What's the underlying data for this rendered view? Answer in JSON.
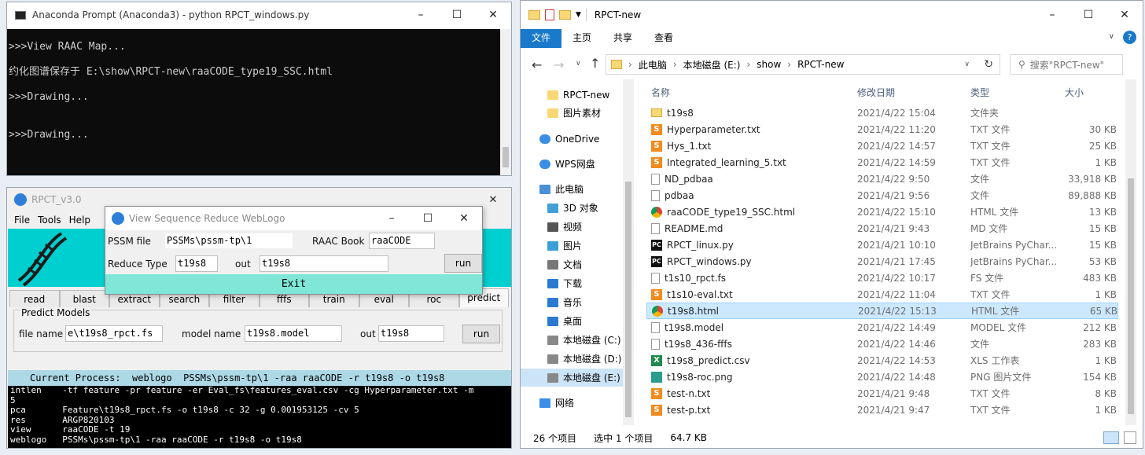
{
  "cmd": {
    "title": "Anaconda Prompt (Anaconda3) - python  RPCT_windows.py",
    "lines": [
      ">>>View RAAC Map...",
      "约化图谱保存于 E:\\show\\RPCT-new\\raaCODE_type19_SSC.html",
      ">>>Drawing...",
      "",
      ">>>Drawing...",
      "",
      "_"
    ]
  },
  "rpct": {
    "title": "RPCT_v3.0",
    "menu": [
      "File",
      "Tools",
      "Help"
    ],
    "tabs": [
      "read",
      "blast",
      "extract",
      "search",
      "filter",
      "fffs",
      "train",
      "eval",
      "roc",
      "predict"
    ],
    "group_title": "Predict Models",
    "file_name_label": "file name",
    "file_name_value": "e\\t19s8_rpct.fs",
    "model_name_label": "model name",
    "model_name_value": "t19s8.model",
    "out_label": "out",
    "out_value": "t19s8",
    "run": "run",
    "status": "Current Process:  weblogo  PSSMs\\pssm-tp\\1 -raa raaCODE -r t19s8 -o t19s8",
    "log": [
      "intlen    -tf feature -pr feature -er Eval_fs\\features_eval.csv -cg Hyperparameter.txt -m",
      "5",
      "pca       Feature\\t19s8_rpct.fs -o t19s8 -c 32 -g 0.001953125 -cv 5",
      "res       ARGP820103",
      "view      raaCODE -t 19",
      "weblogo   PSSMs\\pssm-tp\\1 -raa raaCODE -r t19s8 -o t19s8"
    ]
  },
  "popup": {
    "title": "View Sequence Reduce WebLogo",
    "pssm_label": "PSSM file",
    "pssm_value": "PSSMs\\pssm-tp\\1",
    "raac_label": "RAAC Book",
    "raac_value": "raaCODE",
    "reduce_label": "Reduce Type",
    "reduce_value": "t19s8",
    "out_label": "out",
    "out_value": "t19s8",
    "run": "run",
    "exit": "Exit"
  },
  "explorer": {
    "title": "RPCT-new",
    "ribbon": [
      "文件",
      "主页",
      "共享",
      "查看"
    ],
    "breadcrumb": [
      "此电脑",
      "本地磁盘 (E:)",
      "show",
      "RPCT-new"
    ],
    "search_placeholder": "搜索\"RPCT-new\"",
    "nav": [
      {
        "label": "RPCT-new",
        "icon": "folder-icon"
      },
      {
        "label": "图片素材",
        "icon": "folder-icon"
      },
      {
        "label": "OneDrive",
        "icon": "cloud-icon"
      },
      {
        "label": "WPS网盘",
        "icon": "cloud-icon"
      },
      {
        "label": "此电脑",
        "icon": "computer-icon"
      },
      {
        "label": "3D 对象",
        "icon": "cube-icon"
      },
      {
        "label": "视频",
        "icon": "video-icon"
      },
      {
        "label": "图片",
        "icon": "image-icon"
      },
      {
        "label": "文档",
        "icon": "document-icon"
      },
      {
        "label": "下载",
        "icon": "download-icon"
      },
      {
        "label": "音乐",
        "icon": "music-icon"
      },
      {
        "label": "桌面",
        "icon": "desktop-icon"
      },
      {
        "label": "本地磁盘 (C:)",
        "icon": "drive-icon"
      },
      {
        "label": "本地磁盘 (D:)",
        "icon": "drive-icon"
      },
      {
        "label": "本地磁盘 (E:)",
        "icon": "drive-icon"
      },
      {
        "label": "网络",
        "icon": "network-icon"
      }
    ],
    "columns": [
      "名称",
      "修改日期",
      "类型",
      "大小"
    ],
    "files": [
      {
        "name": "t19s8",
        "date": "2021/4/22 15:04",
        "type": "文件夹",
        "size": "",
        "icon": "folder"
      },
      {
        "name": "Hyperparameter.txt",
        "date": "2021/4/22 11:20",
        "type": "TXT 文件",
        "size": "30 KB",
        "icon": "sublime"
      },
      {
        "name": "Hys_1.txt",
        "date": "2021/4/22 14:57",
        "type": "TXT 文件",
        "size": "25 KB",
        "icon": "sublime"
      },
      {
        "name": "Integrated_learning_5.txt",
        "date": "2021/4/22 14:59",
        "type": "TXT 文件",
        "size": "1 KB",
        "icon": "sublime"
      },
      {
        "name": "ND_pdbaa",
        "date": "2021/4/22 9:50",
        "type": "文件",
        "size": "33,918 KB",
        "icon": "file"
      },
      {
        "name": "pdbaa",
        "date": "2021/4/21 9:56",
        "type": "文件",
        "size": "89,888 KB",
        "icon": "file"
      },
      {
        "name": "raaCODE_type19_SSC.html",
        "date": "2021/4/22 15:10",
        "type": "HTML 文件",
        "size": "13 KB",
        "icon": "chrome"
      },
      {
        "name": "README.md",
        "date": "2021/4/21 9:43",
        "type": "MD 文件",
        "size": "15 KB",
        "icon": "file"
      },
      {
        "name": "RPCT_linux.py",
        "date": "2021/4/21 10:10",
        "type": "JetBrains PyChar...",
        "size": "15 KB",
        "icon": "pycharm"
      },
      {
        "name": "RPCT_windows.py",
        "date": "2021/4/21 17:45",
        "type": "JetBrains PyChar...",
        "size": "53 KB",
        "icon": "pycharm"
      },
      {
        "name": "t1s10_rpct.fs",
        "date": "2021/4/22 10:17",
        "type": "FS 文件",
        "size": "483 KB",
        "icon": "file"
      },
      {
        "name": "t1s10-eval.txt",
        "date": "2021/4/22 11:04",
        "type": "TXT 文件",
        "size": "1 KB",
        "icon": "sublime"
      },
      {
        "name": "t19s8.html",
        "date": "2021/4/22 15:13",
        "type": "HTML 文件",
        "size": "65 KB",
        "icon": "chrome"
      },
      {
        "name": "t19s8.model",
        "date": "2021/4/22 14:49",
        "type": "MODEL 文件",
        "size": "212 KB",
        "icon": "file"
      },
      {
        "name": "t19s8_436-fffs",
        "date": "2021/4/22 14:46",
        "type": "文件",
        "size": "283 KB",
        "icon": "file"
      },
      {
        "name": "t19s8_predict.csv",
        "date": "2021/4/22 14:53",
        "type": "XLS 工作表",
        "size": "1 KB",
        "icon": "xls"
      },
      {
        "name": "t19s8-roc.png",
        "date": "2021/4/22 14:48",
        "type": "PNG 图片文件",
        "size": "154 KB",
        "icon": "image"
      },
      {
        "name": "test-n.txt",
        "date": "2021/4/21 9:48",
        "type": "TXT 文件",
        "size": "8 KB",
        "icon": "sublime"
      },
      {
        "name": "test-p.txt",
        "date": "2021/4/21 9:47",
        "type": "TXT 文件",
        "size": "1 KB",
        "icon": "sublime"
      }
    ],
    "selected_index": 12,
    "status_count": "26 个项目",
    "status_selected": "选中 1 个项目",
    "status_size": "64.7 KB"
  }
}
